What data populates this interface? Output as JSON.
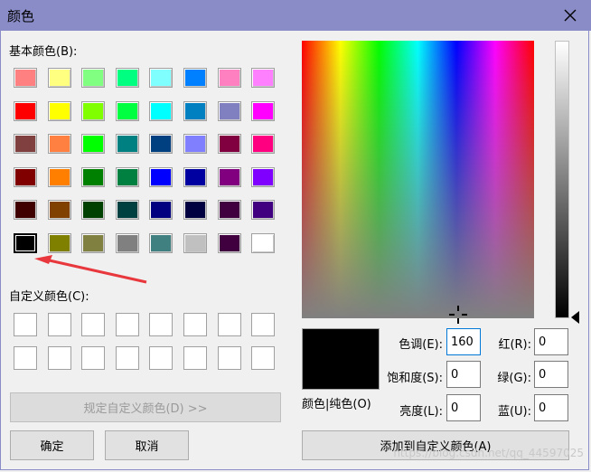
{
  "window": {
    "title": "颜色"
  },
  "basic_label": "基本颜色(B):",
  "custom_label": "自定义颜色(C):",
  "basic_colors": [
    [
      "#ff8080",
      "#ffff80",
      "#80ff80",
      "#00ff80",
      "#80ffff",
      "#0080ff",
      "#ff80c0",
      "#ff80ff"
    ],
    [
      "#ff0000",
      "#ffff00",
      "#80ff00",
      "#00ff40",
      "#00ffff",
      "#0080c0",
      "#8080c0",
      "#ff00ff"
    ],
    [
      "#804040",
      "#ff8040",
      "#00ff00",
      "#008080",
      "#004080",
      "#8080ff",
      "#800040",
      "#ff0080"
    ],
    [
      "#800000",
      "#ff8000",
      "#008000",
      "#008040",
      "#0000ff",
      "#0000a0",
      "#800080",
      "#8000ff"
    ],
    [
      "#400000",
      "#804000",
      "#004000",
      "#004040",
      "#000080",
      "#000040",
      "#400040",
      "#400080"
    ],
    [
      "#000000",
      "#808000",
      "#808040",
      "#808080",
      "#408080",
      "#c0c0c0",
      "#400040",
      "#ffffff"
    ]
  ],
  "buttons": {
    "define_custom": "规定自定义颜色(D) >>",
    "ok": "确定",
    "cancel": "取消",
    "add_custom": "添加到自定义颜色(A)"
  },
  "preview_label": "颜色|纯色(O)",
  "fields": {
    "hue_label": "色调(E):",
    "hue": "160",
    "sat_label": "饱和度(S):",
    "sat": "0",
    "lum_label": "亮度(L):",
    "lum": "0",
    "red_label": "红(R):",
    "red": "0",
    "green_label": "绿(G):",
    "green": "0",
    "blue_label": "蓝(U):",
    "blue": "0"
  },
  "watermark": "https://blog.csdn.net/qq_44597025"
}
